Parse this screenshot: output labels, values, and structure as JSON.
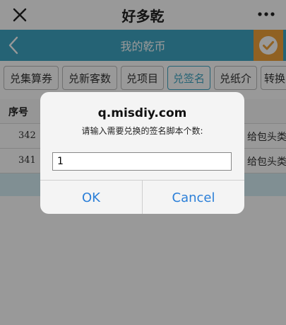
{
  "topbar": {
    "title": "好多乾"
  },
  "header": {
    "title": "我的乾币"
  },
  "tabs": [
    {
      "label": "兑集算券"
    },
    {
      "label": "兑新客数"
    },
    {
      "label": "兑项目"
    },
    {
      "label": "兑签名"
    },
    {
      "label": "兑纸介"
    },
    {
      "label": "转换"
    }
  ],
  "table": {
    "header": {
      "no": "序号"
    },
    "rows": [
      {
        "no": "342",
        "desc": "给包头类"
      },
      {
        "no": "341",
        "desc": "给包头类"
      }
    ]
  },
  "dialog": {
    "title": "q.misdiy.com",
    "message": "请输入需要兑换的签名脚本个数:",
    "input_value": "1",
    "ok_label": "OK",
    "cancel_label": "Cancel"
  },
  "colors": {
    "header_bg": "#3fa6c3",
    "check_bg": "#f0a23a",
    "button_text": "#2b7fd8"
  }
}
